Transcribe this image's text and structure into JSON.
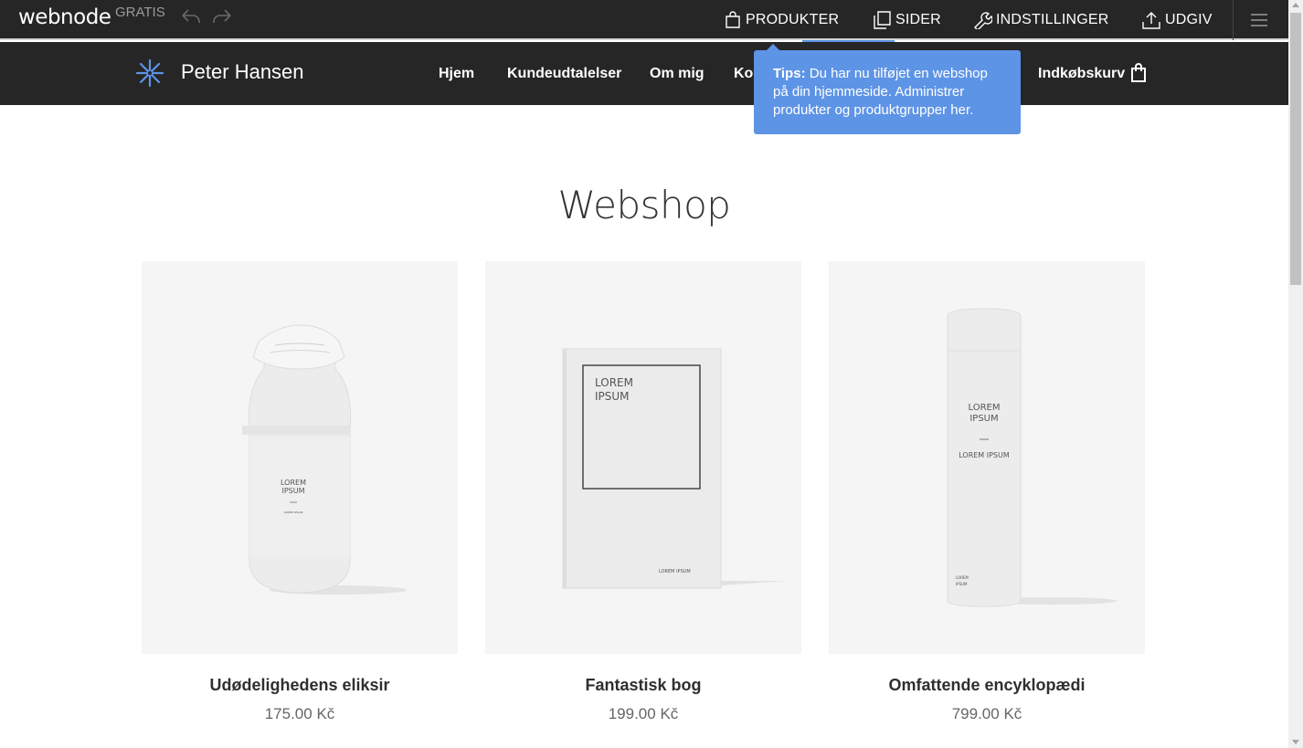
{
  "editor": {
    "logo": "webnode",
    "plan": "GRATIS",
    "items": {
      "produkter": "PRODUKTER",
      "sider": "SIDER",
      "indstillinger": "INDSTILLINGER",
      "udgiv": "UDGIV"
    }
  },
  "site": {
    "title": "Peter Hansen",
    "nav": {
      "hjem": "Hjem",
      "kundeudtalelser": "Kundeudtalelser",
      "om_mig": "Om mig",
      "kontakt_partial": "Kor",
      "cart": "Indkøbskurv"
    }
  },
  "tooltip": {
    "label": "Tips:",
    "text": "Du har nu tilføjet en webshop på din hjemmeside. Administrer produkter og produktgrupper her."
  },
  "main": {
    "title": "Webshop",
    "products": [
      {
        "name": "Udødelighedens eliksir",
        "price": "175.00 Kč",
        "label_main": "LOREM",
        "label_sub": "IPSUM",
        "label_small": "LOREM IPSUM"
      },
      {
        "name": "Fantastisk bog",
        "price": "199.00 Kč",
        "label_main": "LOREM",
        "label_sub": "IPSUM",
        "label_small": "LOREM IPSUM"
      },
      {
        "name": "Omfattende encyklopædi",
        "price": "799.00 Kč",
        "label_main": "LOREM",
        "label_sub": "IPSUM",
        "label_small": "LOREM IPSUM",
        "label_tiny_1": "LOREM",
        "label_tiny_2": "IPSUM"
      }
    ]
  },
  "colors": {
    "dark_bar": "#262626",
    "accent": "#5d94e6",
    "product_bg": "#f4f5f4"
  }
}
